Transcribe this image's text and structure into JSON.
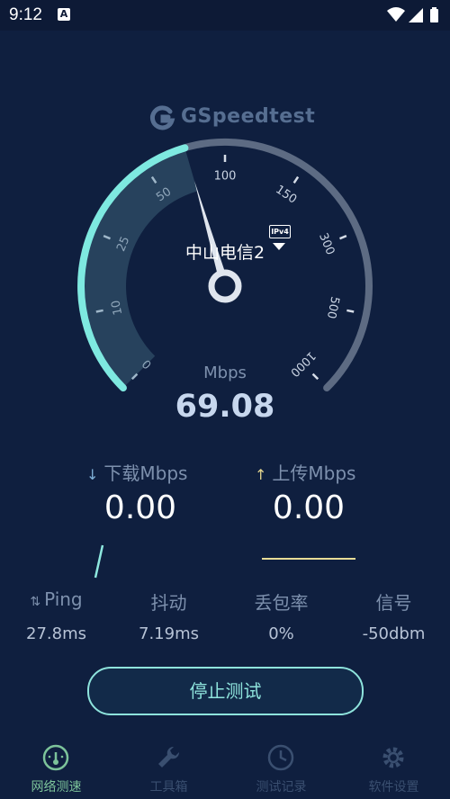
{
  "status_bar": {
    "time": "9:12",
    "notification_icon": "a-icon"
  },
  "app": {
    "logo_text": "GSpeedtest"
  },
  "gauge": {
    "server_name": "中山电信2",
    "ip_badge": "IPv4",
    "unit": "Mbps",
    "speed": "69.08",
    "tick_labels": [
      "0",
      "10",
      "25",
      "50",
      "100",
      "150",
      "300",
      "500",
      "1000"
    ],
    "fill_fraction": 0.44
  },
  "download": {
    "label": "下载Mbps",
    "value": "0.00"
  },
  "upload": {
    "label": "上传Mbps",
    "value": "0.00"
  },
  "stats": [
    {
      "label": "Ping",
      "value": "27.8ms"
    },
    {
      "label": "抖动",
      "value": "7.19ms"
    },
    {
      "label": "丢包率",
      "value": "0%"
    },
    {
      "label": "信号",
      "value": "-50dbm"
    }
  ],
  "stop_button": {
    "label": "停止测试"
  },
  "tabs": [
    {
      "label": "网络测速",
      "icon": "speedometer-icon",
      "active": true
    },
    {
      "label": "工具箱",
      "icon": "wrench-icon",
      "active": false
    },
    {
      "label": "测试记录",
      "icon": "clock-icon",
      "active": false
    },
    {
      "label": "软件设置",
      "icon": "gear-icon",
      "active": false
    }
  ],
  "colors": {
    "background": "#0f1f3f",
    "accent_teal": "#7ee9e0",
    "upload_yellow": "#e8dc96",
    "active_tab": "#7cc39a"
  }
}
